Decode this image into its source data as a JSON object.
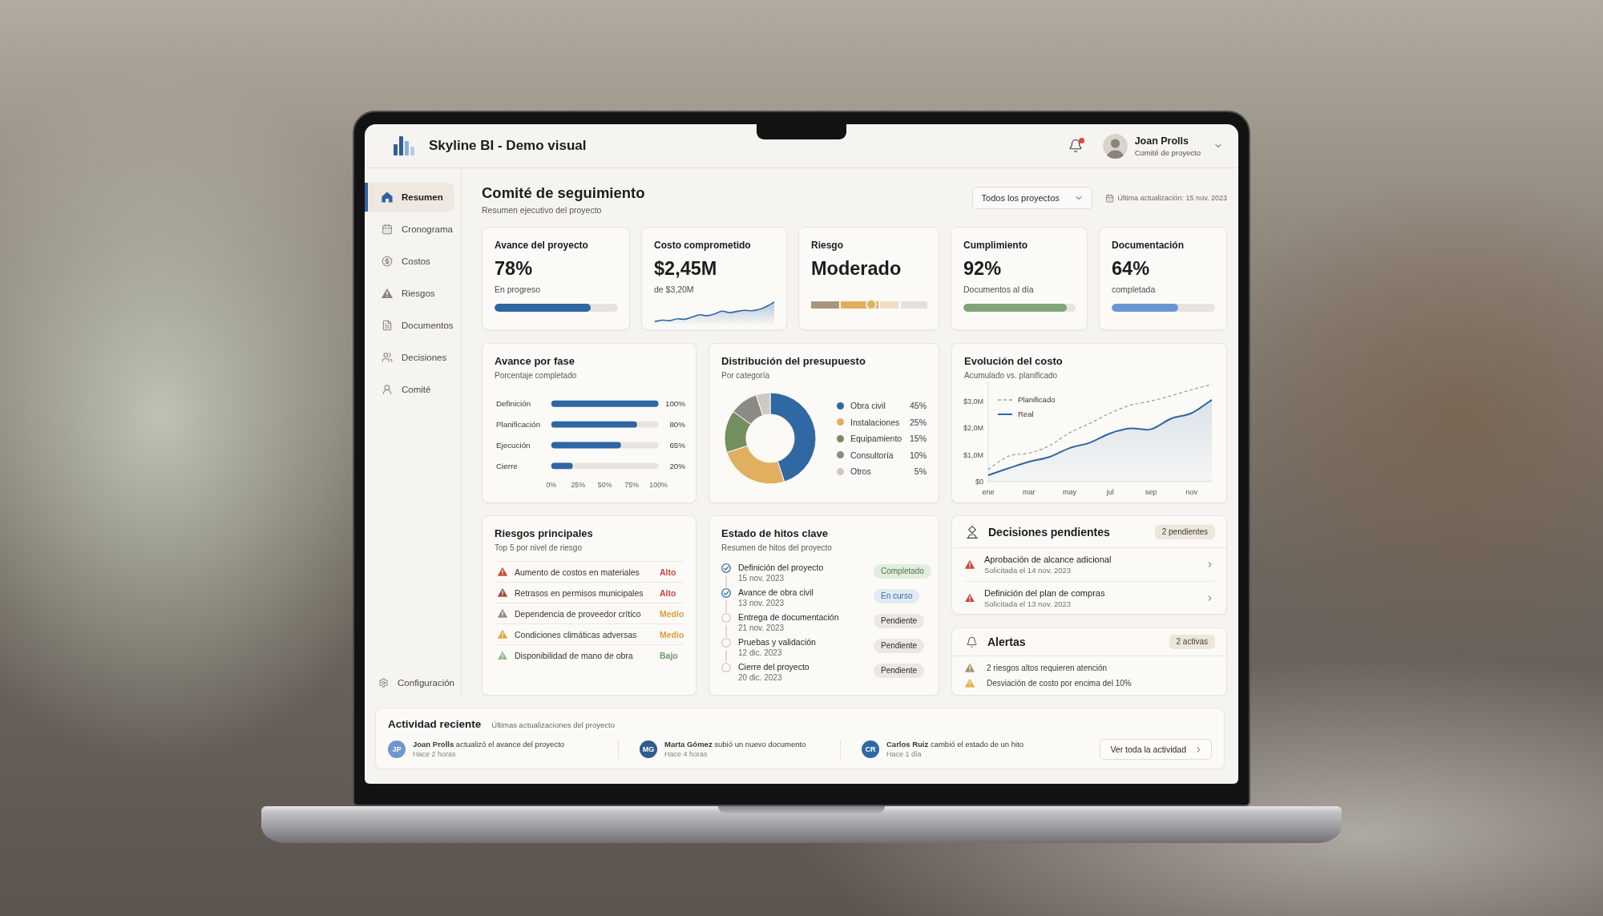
{
  "header": {
    "title": "Skyline BI - Demo visual",
    "notifications": {
      "unread": true
    },
    "user": {
      "name": "Joan Prolls",
      "role": "Comité de proyecto"
    }
  },
  "sidebar": {
    "items": [
      {
        "label": "Resumen",
        "selected": true
      },
      {
        "label": "Cronograma",
        "selected": false
      },
      {
        "label": "Costos",
        "selected": false
      },
      {
        "label": "Riesgos",
        "selected": false
      },
      {
        "label": "Documentos",
        "selected": false
      },
      {
        "label": "Decisiones",
        "selected": false
      },
      {
        "label": "Comité",
        "selected": false
      }
    ],
    "settings": {
      "label": "Configuración",
      "selected": false
    }
  },
  "page": {
    "title": "Comité de seguimiento",
    "subtitle": "Resumen ejecutivo del proyecto",
    "project_filter": {
      "value": "Todos los proyectos"
    },
    "last_update": "Última actualización: 15 nov. 2023"
  },
  "kpis": [
    {
      "kind": "progress",
      "title": "Avance del proyecto",
      "value": "78%",
      "caption": "En progreso",
      "level": 0.78,
      "color": "#2f66a3"
    },
    {
      "kind": "sparkline",
      "title": "Costo comprometido",
      "value": "$2,45M",
      "caption": "de $3,20M"
    },
    {
      "kind": "gauge",
      "title": "Riesgo",
      "value": "Moderado",
      "level": 0.52
    },
    {
      "kind": "progress",
      "title": "Cumplimiento",
      "value": "92%",
      "caption": "Documentos al día",
      "level": 0.92,
      "color": "#7fa676"
    },
    {
      "kind": "progress",
      "title": "Documentación",
      "value": "64%",
      "caption": "completada",
      "level": 0.64,
      "color": "#6a97d4"
    }
  ],
  "phase_progress": {
    "title": "Avance por fase",
    "subtitle": "Porcentaje completado",
    "chart_data": {
      "type": "bar",
      "orientation": "horizontal",
      "categories": [
        "Definición",
        "Planificación",
        "Ejecución",
        "Cierre"
      ],
      "values": [
        100,
        80,
        65,
        20
      ],
      "value_labels": [
        "100%",
        "80%",
        "65%",
        "20%"
      ],
      "xlim": [
        0,
        100
      ],
      "xticks": [
        {
          "value": 0,
          "label": "0%"
        },
        {
          "value": 25,
          "label": "25%"
        },
        {
          "value": 50,
          "label": "50%"
        },
        {
          "value": 75,
          "label": "75%"
        },
        {
          "value": 100,
          "label": "100%"
        }
      ]
    }
  },
  "budget": {
    "title": "Distribución del presupuesto",
    "subtitle": "Por categoría",
    "chart_data": {
      "type": "donut",
      "categories": [
        "Obra civil",
        "Instalaciones",
        "Equipamiento",
        "Consultoría",
        "Otros"
      ],
      "values": [
        45,
        25,
        15,
        10,
        5
      ],
      "value_labels": [
        "45%",
        "25%",
        "15%",
        "10%",
        "5%"
      ],
      "colors": [
        "#2f68a3",
        "#e0af5f",
        "#748f5e",
        "#8c8a85",
        "#cdcac4"
      ],
      "legend": "right"
    }
  },
  "cost_trend": {
    "title": "Evolución del costo",
    "subtitle": "Acumulado vs. planificado",
    "chart_data": {
      "type": "line",
      "categories": [
        "ene",
        null,
        "mar",
        null,
        "may",
        null,
        "jul",
        null,
        "sep",
        null,
        "nov",
        null
      ],
      "ylim": [
        0,
        3.7
      ],
      "yticks": [
        {
          "value": 0,
          "label": "$0"
        },
        {
          "value": 1,
          "label": "$1,0M"
        },
        {
          "value": 2,
          "label": "$2,0M"
        },
        {
          "value": 3,
          "label": "$3,0M"
        }
      ],
      "legend": "upper left",
      "series": [
        {
          "name": "Planificado",
          "color": "#9c9a96",
          "line_style": "dashed",
          "values": [
            0.45,
            0.95,
            1.06,
            1.33,
            1.82,
            2.17,
            2.55,
            2.85,
            3.0,
            3.2,
            3.42,
            3.62
          ]
        },
        {
          "name": "Real",
          "color": "#2f66a3",
          "type": "area",
          "values": [
            0.24,
            0.5,
            0.74,
            0.92,
            1.25,
            1.45,
            1.8,
            1.98,
            1.95,
            2.35,
            2.55,
            3.05
          ]
        }
      ]
    }
  },
  "risks": {
    "title": "Riesgos principales",
    "subtitle": "Top 5 por nivel de riesgo",
    "items": [
      {
        "label": "Aumento de costos en materiales",
        "color": "#c9473b",
        "rating": {
          "text": "Alto",
          "color": "#c9473d"
        }
      },
      {
        "label": "Retrasos en permisos municipales",
        "color": "#a54a3f",
        "rating": {
          "text": "Alto",
          "color": "#c9473d"
        }
      },
      {
        "label": "Dependencia de proveedor crítico",
        "color": "#8f8c86",
        "rating": {
          "text": "Medio",
          "color": "#d99d3a"
        }
      },
      {
        "label": "Condiciones climáticas adversas",
        "color": "#e2a63f",
        "rating": {
          "text": "Medio",
          "color": "#d99d3a"
        }
      },
      {
        "label": "Disponibilidad de mano de obra",
        "color": "#8bb884",
        "rating": {
          "text": "Bajo",
          "color": "#6d9c66"
        }
      }
    ]
  },
  "milestones": {
    "title": "Estado de hitos clave",
    "subtitle": "Resumen de hitos del proyecto",
    "items": [
      {
        "title": "Definición del proyecto",
        "date": "15 nov. 2023",
        "done": true,
        "status": {
          "text": "Completado",
          "kind": "completed"
        }
      },
      {
        "title": "Avance de obra civil",
        "date": "13 nov. 2023",
        "done": true,
        "status": {
          "text": "En curso",
          "kind": "in_progress"
        }
      },
      {
        "title": "Entrega de documentación",
        "date": "21 nov. 2023",
        "done": false,
        "status": {
          "text": "Pendiente",
          "kind": "pending"
        }
      },
      {
        "title": "Pruebas y validación",
        "date": "12 dic. 2023",
        "done": false,
        "status": {
          "text": "Pendiente",
          "kind": "pending"
        }
      },
      {
        "title": "Cierre del proyecto",
        "date": "20 dic. 2023",
        "done": false,
        "status": {
          "text": "Pendiente",
          "kind": "pending"
        }
      }
    ]
  },
  "decisions": {
    "title": "Decisiones pendientes",
    "badge": "2 pendientes",
    "items": [
      {
        "title": "Aprobación de alcance adicional",
        "date": "Solicitada el 14 nov. 2023"
      },
      {
        "title": "Definición del plan de compras",
        "date": "Solicitada el 13 nov. 2023"
      }
    ]
  },
  "alerts": {
    "title": "Alertas",
    "badge": "2 activas",
    "items": [
      {
        "text": "2 riesgos altos requieren atención",
        "color": "#a69470"
      },
      {
        "text": "Desviación de costo por encima del 10%",
        "color": "#e5ae4e"
      }
    ]
  },
  "activity": {
    "title": "Actividad reciente",
    "subtitle": "Últimas actualizaciones del proyecto",
    "items": [
      {
        "initials": "JP",
        "text": "**Joan Prolls** actualizó el avance del proyecto",
        "time": "Hace 2 horas",
        "color": "#6e96cf"
      },
      {
        "initials": "MG",
        "text": "**Marta Gómez** subió un nuevo documento",
        "time": "Hace 4 horas",
        "color": "#2e5c8c"
      },
      {
        "initials": "CR",
        "text": "**Carlos Ruiz** cambió el estado de un hito",
        "time": "Hace 1 día",
        "color": "#2f68a5"
      }
    ],
    "button": "Ver toda la actividad"
  }
}
